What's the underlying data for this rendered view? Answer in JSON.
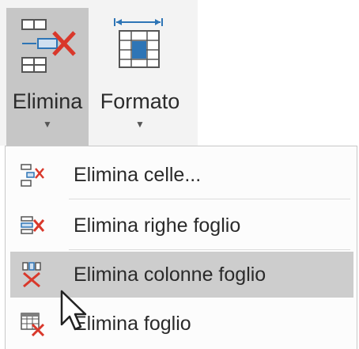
{
  "ribbon": {
    "delete_button": {
      "label": "Elimina",
      "icon": "delete-cells-icon"
    },
    "format_button": {
      "label": "Formato",
      "icon": "format-column-width-icon"
    }
  },
  "menu": {
    "items": [
      {
        "label": "Elimina celle...",
        "icon": "delete-cells-icon",
        "selected": false
      },
      {
        "label": "Elimina righe foglio",
        "icon": "delete-rows-icon",
        "selected": false
      },
      {
        "label": "Elimina colonne foglio",
        "icon": "delete-columns-icon",
        "selected": true
      },
      {
        "label": "Elimina foglio",
        "icon": "delete-sheet-icon",
        "selected": false
      }
    ]
  },
  "colors": {
    "delete_red": "#d9382b",
    "selected_bg": "#cdcdcd",
    "accent_blue": "#2e75b6"
  }
}
